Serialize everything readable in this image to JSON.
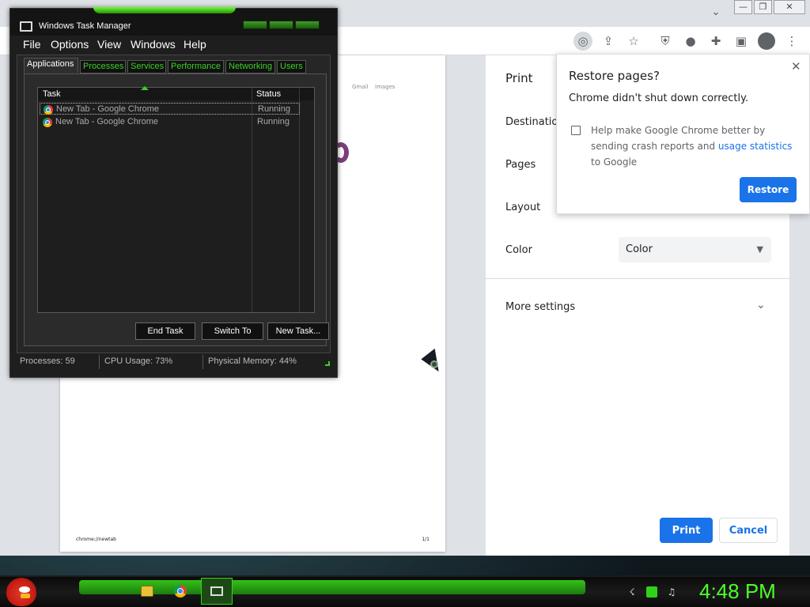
{
  "chrome": {
    "window_controls": {
      "minimize": "—",
      "restore": "❐",
      "close": "✕"
    },
    "toolbar_icons": [
      "lens-icon",
      "share-icon",
      "star-icon",
      "ublock-icon",
      "extension-flag-icon",
      "puzzle-icon",
      "side-panel-icon",
      "profile-icon",
      "kebab-menu-icon"
    ]
  },
  "preview": {
    "links": [
      "Gmail",
      "Images"
    ],
    "footer_url": "chrome://newtab",
    "footer_page": "1/1"
  },
  "print_panel": {
    "title": "Print",
    "destination_label": "Destination",
    "pages_label": "Pages",
    "layout_label": "Layout",
    "color_label": "Color",
    "color_value": "Color",
    "more_settings": "More settings",
    "print_button": "Print",
    "cancel_button": "Cancel"
  },
  "restore_popup": {
    "title": "Restore pages?",
    "message": "Chrome didn't shut down correctly.",
    "help_text_1": "Help make Google Chrome better by sending crash reports and ",
    "help_link": "usage statistics",
    "help_text_2": " to Google",
    "restore_button": "Restore",
    "close": "✕"
  },
  "task_manager": {
    "title": "Windows Task Manager",
    "menus": [
      "File",
      "Options",
      "View",
      "Windows",
      "Help"
    ],
    "tabs": [
      "Applications",
      "Processes",
      "Services",
      "Performance",
      "Networking",
      "Users"
    ],
    "columns": {
      "task": "Task",
      "status": "Status"
    },
    "rows": [
      {
        "task": "New Tab - Google Chrome",
        "status": "Running"
      },
      {
        "task": "New Tab - Google Chrome",
        "status": "Running"
      }
    ],
    "buttons": {
      "end_task": "End Task",
      "switch_to": "Switch To",
      "new_task": "New Task..."
    },
    "status": {
      "processes": "Processes: 59",
      "cpu": "CPU Usage: 73%",
      "memory": "Physical Memory: 44%"
    }
  },
  "taskbar": {
    "clock": "4:48 PM",
    "accent_color": "#3ad125"
  }
}
